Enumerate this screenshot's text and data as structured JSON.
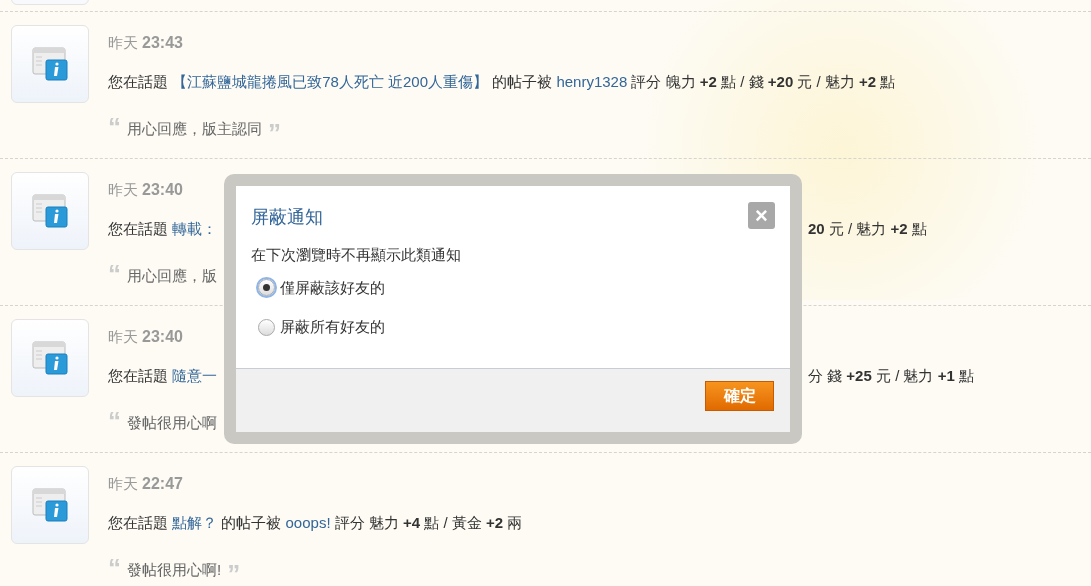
{
  "notifications": [
    {
      "time_label": "昨天",
      "time": "23:43",
      "left": [
        {
          "kind": "text",
          "text": "您在話題 "
        },
        {
          "kind": "link",
          "text": "【江蘇鹽城龍捲風已致78人死亡 近200人重傷】"
        },
        {
          "kind": "text",
          "text": " 的帖子被 "
        },
        {
          "kind": "link",
          "text": "henry1328"
        },
        {
          "kind": "text",
          "text": " 評分 魄力 **+2** 點 / 錢 **+20** 元 / 魅力 **+2** 點"
        }
      ],
      "quote": {
        "open": "“",
        "text": "用心回應，版主認同",
        "close": "”"
      }
    },
    {
      "time_label": "昨天",
      "time": "23:40",
      "left": [
        {
          "kind": "text",
          "text": "您在話題 "
        },
        {
          "kind": "link",
          "text": "轉載："
        }
      ],
      "tail": "**20** 元 / 魅力 **+2** 點",
      "quote": {
        "open": "“",
        "text": "用心回應，版"
      }
    },
    {
      "time_label": "昨天",
      "time": "23:40",
      "left": [
        {
          "kind": "text",
          "text": "您在話題 "
        },
        {
          "kind": "link",
          "text": "隨意一"
        }
      ],
      "tail": "分 錢 **+25** 元 / 魅力 **+1** 點",
      "quote": {
        "open": "“",
        "text": "發帖很用心啊"
      }
    },
    {
      "time_label": "昨天",
      "time": "22:47",
      "left": [
        {
          "kind": "text",
          "text": "您在話題 "
        },
        {
          "kind": "link",
          "text": "點解？"
        },
        {
          "kind": "text",
          "text": " 的帖子被 "
        },
        {
          "kind": "link",
          "text": "ooops!"
        },
        {
          "kind": "text",
          "text": " 評分 魅力 **+4** 點 / 黃金 **+2** 兩"
        }
      ],
      "quote": {
        "open": "“",
        "text": "發帖很用心啊!",
        "close": "”"
      }
    }
  ],
  "dialog": {
    "title": "屏蔽通知",
    "close": "×",
    "description": "在下次瀏覽時不再顯示此類通知",
    "options": [
      {
        "label": "僅屏蔽該好友的",
        "selected": true
      },
      {
        "label": "屏蔽所有好友的",
        "selected": false
      }
    ],
    "confirm": "確定"
  }
}
